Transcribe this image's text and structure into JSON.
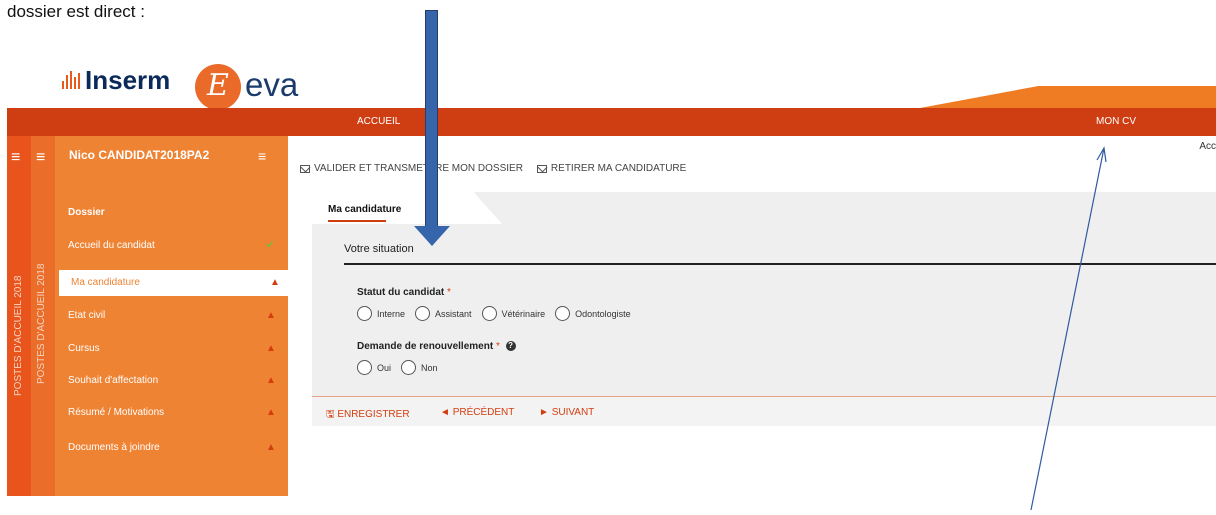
{
  "doc_text": "dossier est direct :",
  "brand": {
    "inserm": "Inserm",
    "eva_letter": "E",
    "eva": "eva"
  },
  "topnav": {
    "accueil": "ACCUEIL",
    "mon_cv": "MON CV"
  },
  "strips": {
    "outer": "POSTES D'ACCUEIL 2018",
    "inner": "POSTES D'ACCUEIL 2018"
  },
  "sidebar": {
    "user": "Nico CANDIDAT2018PA2",
    "section": "Dossier",
    "items": [
      {
        "label": "Accueil du candidat",
        "status": "✔",
        "kind": "ok"
      },
      {
        "label": "Ma candidature",
        "status": "▲",
        "kind": "warn"
      },
      {
        "label": "Etat civil",
        "status": "▲",
        "kind": "warn"
      },
      {
        "label": "Cursus",
        "status": "▲",
        "kind": "warn"
      },
      {
        "label": "Souhait d'affectation",
        "status": "▲",
        "kind": "warn"
      },
      {
        "label": "Résumé / Motivations",
        "status": "▲",
        "kind": "warn"
      },
      {
        "label": "Documents à joindre",
        "status": "▲",
        "kind": "warn"
      }
    ]
  },
  "header_right": "Acc",
  "actions": {
    "validate": "VALIDER ET TRANSMETTRE MON DOSSIER",
    "withdraw": "RETIRER MA CANDIDATURE"
  },
  "form": {
    "tab": "Ma candidature",
    "section": "Votre situation",
    "status_label": "Statut du candidat",
    "status_options": [
      "Interne",
      "Assistant",
      "Vétérinaire",
      "Odontologiste"
    ],
    "renewal_label": "Demande de renouvellement",
    "renewal_options": [
      "Oui",
      "Non"
    ],
    "required_mark": "*",
    "help_mark": "?"
  },
  "footer": {
    "save": "ENREGISTRER",
    "prev": "PRÉCÉDENT",
    "next": "SUIVANT"
  },
  "colors": {
    "brand_orange": "#ef8334",
    "nav_red": "#cf3d12",
    "arrow_blue": "#3765ab"
  }
}
